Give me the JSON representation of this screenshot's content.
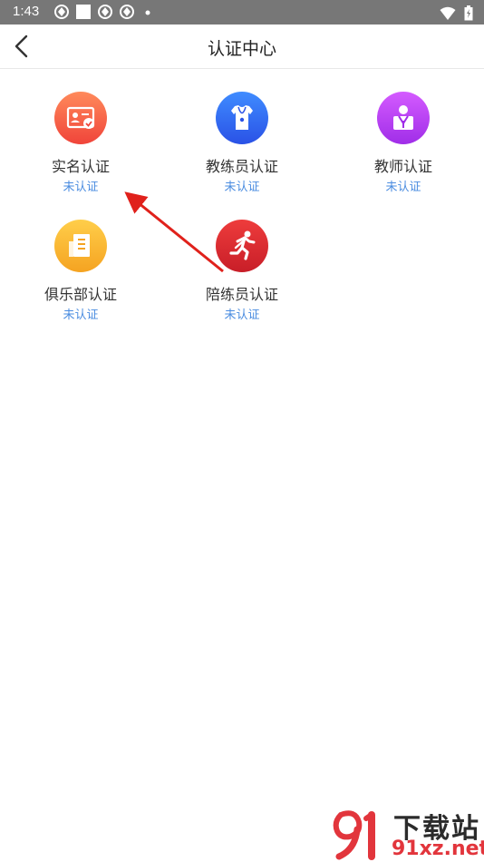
{
  "status_bar": {
    "time": "1:43"
  },
  "header": {
    "title": "认证中心"
  },
  "items": [
    {
      "label": "实名认证",
      "status": "未认证",
      "color_top": "#ff8a5b",
      "color_bottom": "#f0443a",
      "icon": "id-card-icon"
    },
    {
      "label": "教练员认证",
      "status": "未认证",
      "color_top": "#3f8cff",
      "color_bottom": "#2a52e6",
      "icon": "coach-shirt-icon"
    },
    {
      "label": "教师认证",
      "status": "未认证",
      "color_top": "#d45bff",
      "color_bottom": "#a02ee8",
      "icon": "teacher-icon"
    },
    {
      "label": "俱乐部认证",
      "status": "未认证",
      "color_top": "#ffce4a",
      "color_bottom": "#f5a321",
      "icon": "building-icon"
    },
    {
      "label": "陪练员认证",
      "status": "未认证",
      "color_top": "#ee3c3c",
      "color_bottom": "#c81e28",
      "icon": "runner-icon"
    }
  ],
  "watermark": {
    "text": "下载站",
    "url": "91xz.net"
  }
}
